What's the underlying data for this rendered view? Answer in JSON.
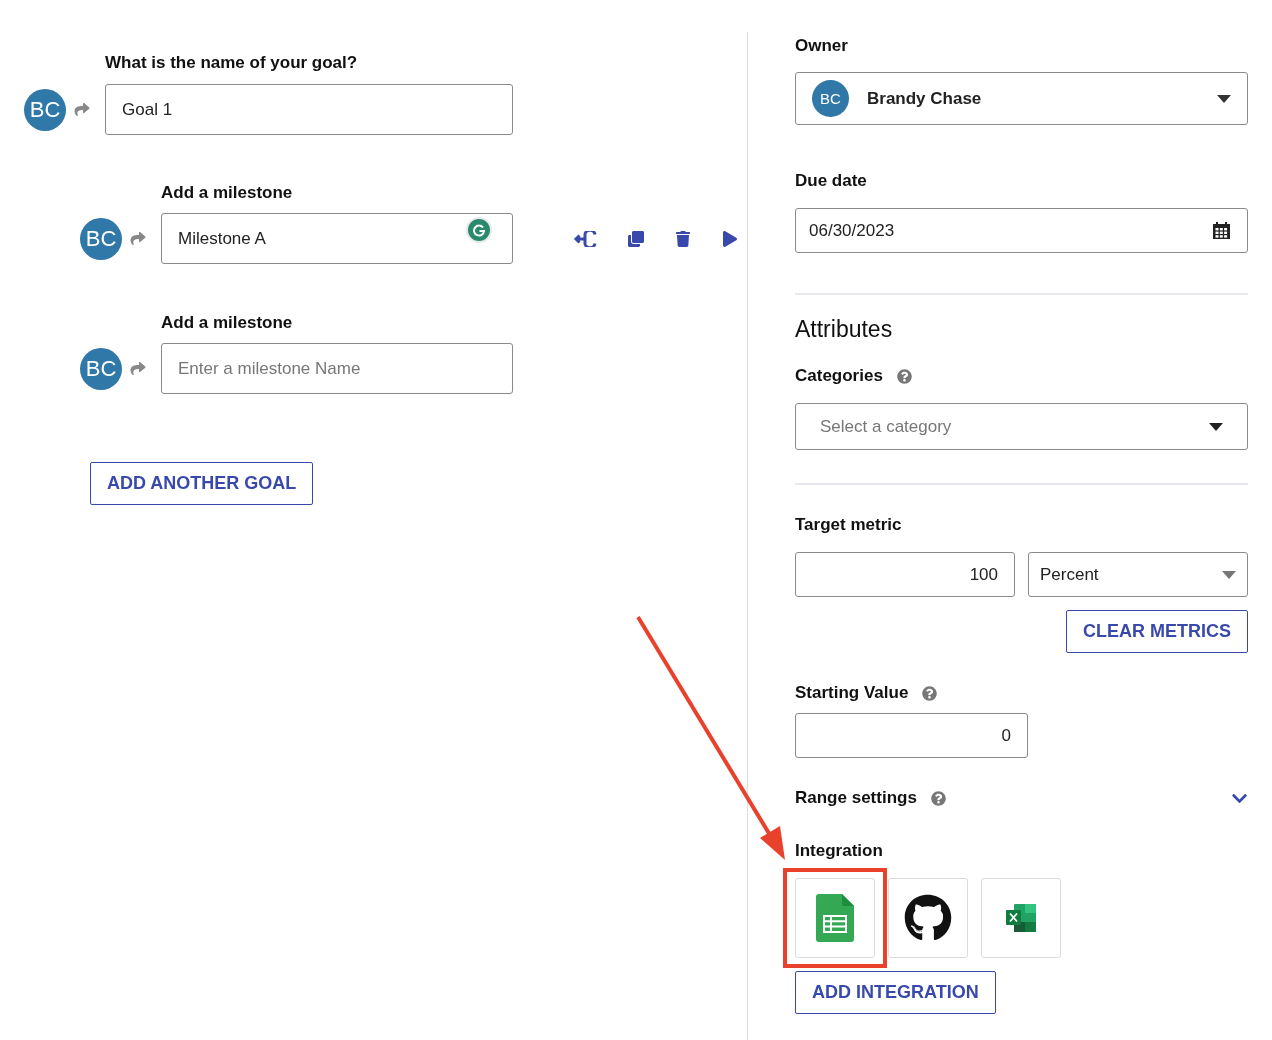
{
  "goal": {
    "label": "What is the name of your goal?",
    "avatar": "BC",
    "value": "Goal 1"
  },
  "milestones": [
    {
      "label": "Add a milestone",
      "avatar": "BC",
      "value": "Milestone A",
      "tools": true
    },
    {
      "label": "Add a milestone",
      "avatar": "BC",
      "placeholder": "Enter a milestone Name",
      "tools": false
    }
  ],
  "add_goal_button": "ADD ANOTHER GOAL",
  "owner": {
    "label": "Owner",
    "avatar": "BC",
    "name": "Brandy Chase"
  },
  "due_date": {
    "label": "Due date",
    "value": "06/30/2023"
  },
  "attributes": {
    "title": "Attributes",
    "categories": {
      "label": "Categories",
      "placeholder": "Select a category"
    }
  },
  "target_metric": {
    "label": "Target metric",
    "value": "100",
    "unit": "Percent",
    "clear_button": "CLEAR METRICS"
  },
  "starting_value": {
    "label": "Starting Value",
    "value": "0"
  },
  "range_settings": {
    "label": "Range settings",
    "expanded": false
  },
  "integration": {
    "label": "Integration",
    "items": [
      {
        "kind": "sheets",
        "highlighted": true
      },
      {
        "kind": "github",
        "highlighted": false
      },
      {
        "kind": "excel",
        "highlighted": false
      }
    ],
    "add_button": "ADD INTEGRATION"
  }
}
